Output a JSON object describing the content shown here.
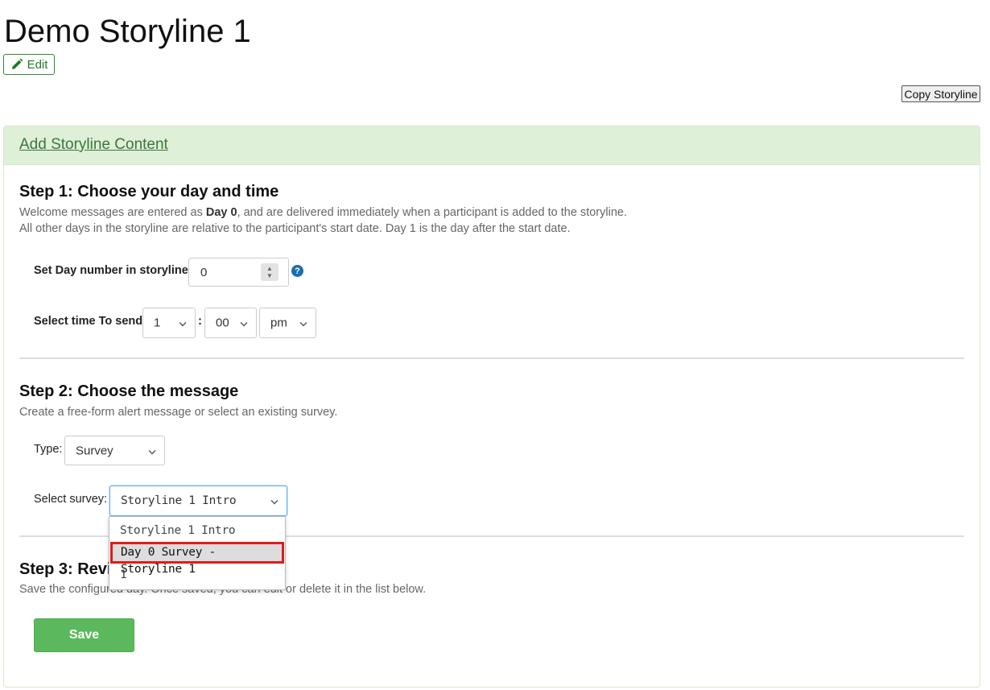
{
  "title": "Demo Storyline 1",
  "edit_label": "Edit",
  "copy_label": "Copy Storyline",
  "panel": {
    "header_link": "Add Storyline Content"
  },
  "step1": {
    "title": "Step 1: Choose your day and time",
    "desc_line1_pre": "Welcome messages are entered as ",
    "desc_line1_bold": "Day 0",
    "desc_line1_post": ", and are delivered immediately when a participant is added to the storyline.",
    "desc_line2": "All other days in the storyline are relative to the participant's start date. Day 1 is the day after the start date.",
    "day_label": "Set Day number in storyline:",
    "day_value": "0",
    "time_label": "Select time To send:",
    "hour": "1",
    "minute": "00",
    "ampm": "pm",
    "colon": ":"
  },
  "step2": {
    "title": "Step 2: Choose the message",
    "desc": "Create a free-form alert message or select an existing survey.",
    "type_label": "Type:",
    "type_value": "Survey",
    "survey_label": "Select survey:",
    "survey_value": "Storyline 1 Intro",
    "survey_options": [
      "Storyline 1 Intro",
      "Day 0 Survey - Storyline 1",
      "1"
    ]
  },
  "step3": {
    "title": "Step 3: Review",
    "desc": "Save the configured day. Once saved, you can edit or delete it in the list below.",
    "save_label": "Save"
  },
  "colors": {
    "accent_green": "#5cb85c",
    "panel_header_bg": "#dff0d8",
    "highlight_border": "#e01b1b"
  }
}
